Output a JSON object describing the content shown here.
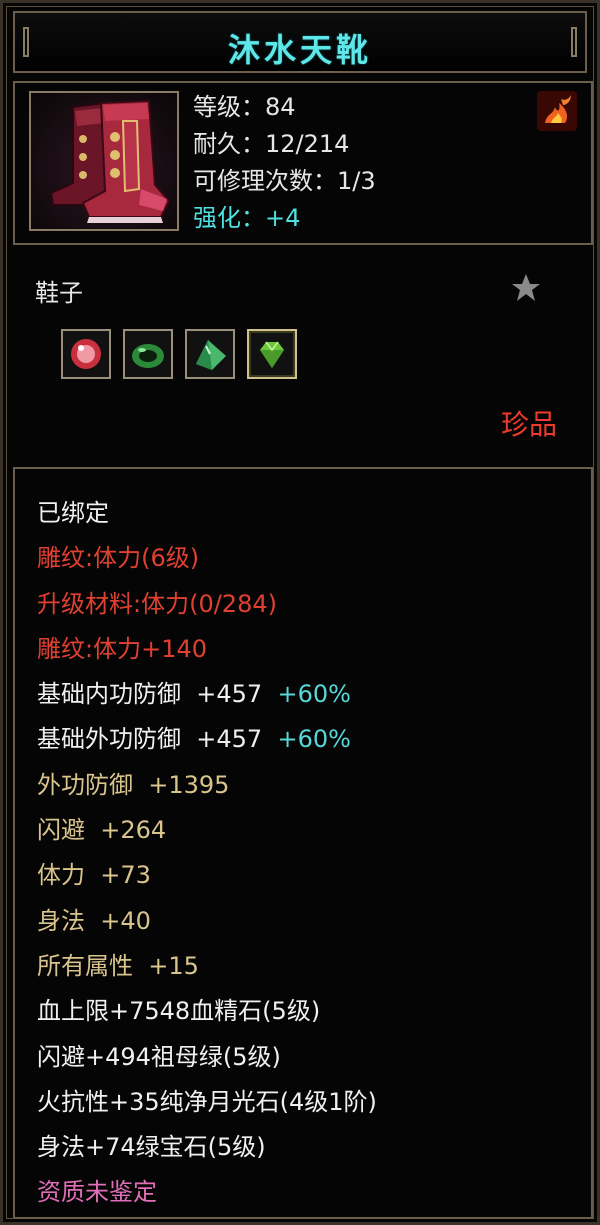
{
  "item": {
    "name": "沐水天靴",
    "type": "鞋子",
    "rarity": "珍品",
    "icon": "boots-icon"
  },
  "stats": {
    "level": "等级：84",
    "durability": "耐久：12/214",
    "repairs": "可修理次数：1/3",
    "enhance": "强化：+4"
  },
  "gems": [
    {
      "icon": "ruby-gem-icon",
      "color": "#d64a5a"
    },
    {
      "icon": "jade-ring-icon",
      "color": "#3aa84a"
    },
    {
      "icon": "green-crystal-icon",
      "color": "#5ac87a"
    },
    {
      "icon": "emerald-gem-icon",
      "color": "#7ad84a"
    }
  ],
  "attributes": {
    "bound": "已绑定",
    "engrave_level": "雕纹:体力(6级)",
    "upgrade_material": "升级材料:体力(0/284)",
    "engrave_bonus": "雕纹:体力+140",
    "inner_def_label": "基础内功防御  +457",
    "inner_def_pct": "+60%",
    "outer_def_label": "基础外功防御  +457",
    "outer_def_pct": "+60%",
    "outer_def": "外功防御  +1395",
    "dodge": "闪避  +264",
    "stamina": "体力  +73",
    "agility": "身法  +40",
    "all_attr": "所有属性  +15",
    "hp_gem": "血上限+7548血精石(5级)",
    "dodge_gem": "闪避+494祖母绿(5级)",
    "fire_gem": "火抗性+35纯净月光石(4级1阶)",
    "agility_gem": "身法+74绿宝石(5级)",
    "quality": "资质未鉴定"
  },
  "colors": {
    "title": "#5ee6e8",
    "red": "#e04030",
    "gold": "#d8c48c",
    "cyan": "#56d8d8",
    "pink": "#e06fb8",
    "rarity": "#ee3a2c"
  }
}
